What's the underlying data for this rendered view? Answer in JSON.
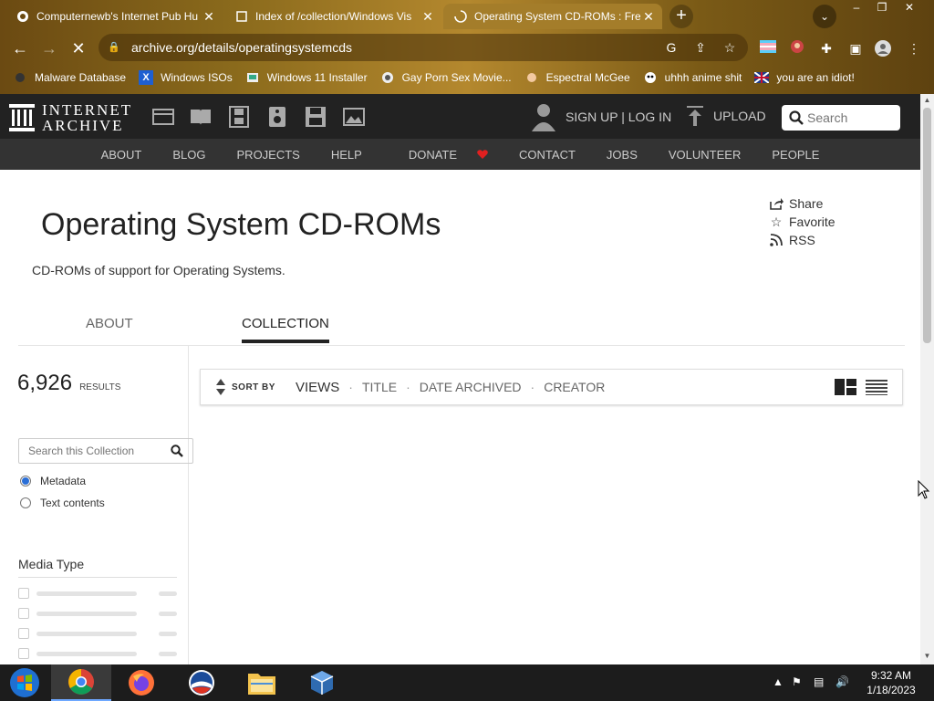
{
  "browser": {
    "tabs": [
      {
        "title": "Computernewb's Internet Pub Hu",
        "icon": "pub-favicon",
        "active": false
      },
      {
        "title": "Index of /collection/Windows Vis",
        "icon": "index-favicon",
        "active": false
      },
      {
        "title": "Operating System CD-ROMs : Fre",
        "icon": "loading-spinner",
        "active": true
      }
    ],
    "new_tab": "+",
    "tab_search": "⌄",
    "window_controls": [
      "–",
      "❐",
      "✕"
    ],
    "url": "archive.org/details/operatingsystemcds",
    "bookmarks": [
      {
        "label": "Malware Database",
        "icon": "malware-icon"
      },
      {
        "label": "Windows ISOs",
        "icon": "windows-iso-icon"
      },
      {
        "label": "Windows 11 Installer",
        "icon": "installer-icon"
      },
      {
        "label": "Gay Porn Sex Movie...",
        "icon": "bookmark-favicon"
      },
      {
        "label": "Espectral McGee",
        "icon": "bookmark-favicon"
      },
      {
        "label": "uhhh anime shit",
        "icon": "bookmark-favicon"
      },
      {
        "label": "you are an idiot!",
        "icon": "bookmark-favicon"
      }
    ]
  },
  "ia_header": {
    "logo_line1": "INTERNET",
    "logo_line2": "ARCHIVE",
    "signin": "SIGN UP | LOG IN",
    "upload": "UPLOAD",
    "search_placeholder": "Search"
  },
  "ia_nav": [
    "ABOUT",
    "BLOG",
    "PROJECTS",
    "HELP",
    "DONATE",
    "CONTACT",
    "JOBS",
    "VOLUNTEER",
    "PEOPLE"
  ],
  "page": {
    "title": "Operating System CD-ROMs",
    "description": "CD-ROMs of support for Operating Systems.",
    "actions": {
      "share": "Share",
      "favorite": "Favorite",
      "rss": "RSS"
    },
    "tabs": {
      "about": "ABOUT",
      "collection": "COLLECTION"
    },
    "results_count": "6,926",
    "results_label": "RESULTS",
    "sort_by": "SORT BY",
    "sort_options": [
      "VIEWS",
      "TITLE",
      "DATE ARCHIVED",
      "CREATOR"
    ],
    "collection_search_placeholder": "Search this Collection",
    "search_scope": {
      "metadata": "Metadata",
      "text": "Text contents"
    },
    "media_type_heading": "Media Type"
  },
  "taskbar": {
    "clock_time": "9:32 AM",
    "clock_date": "1/18/2023"
  },
  "colors": {
    "ia_header_bg": "#222222",
    "ia_nav_bg": "#333333",
    "donate_heart": "#e02020",
    "radio_selected": "#2a6ed6"
  }
}
